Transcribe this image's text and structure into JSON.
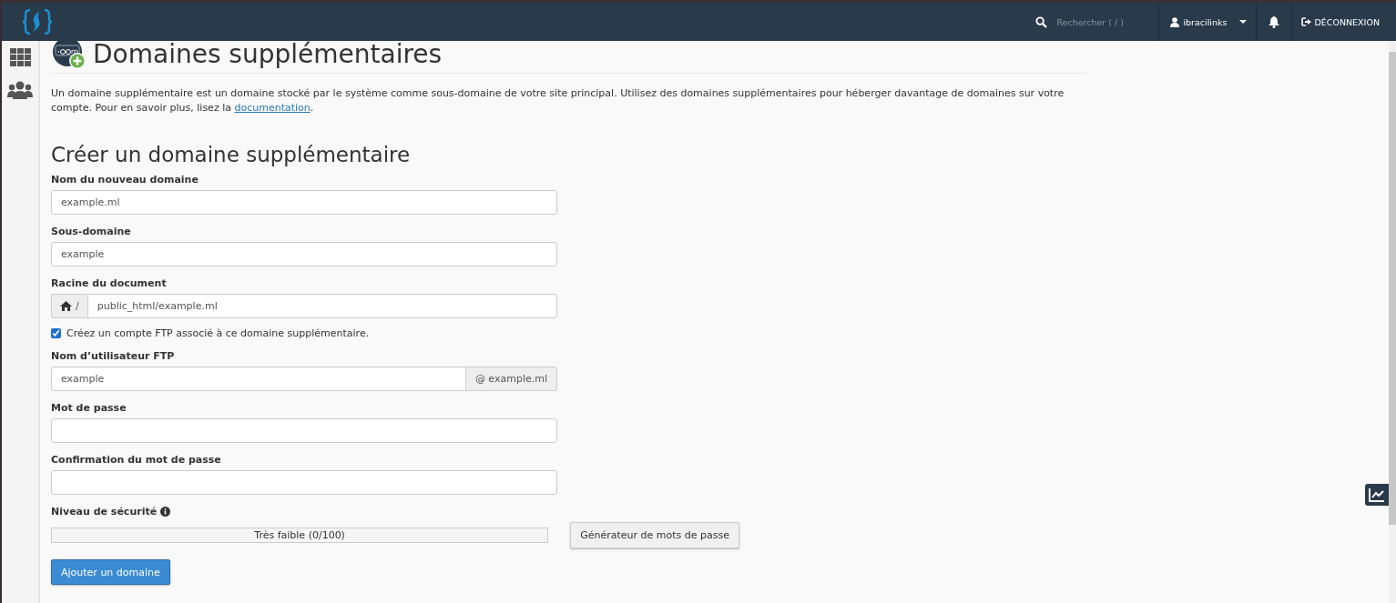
{
  "navbar": {
    "search": {
      "placeholder": "Rechercher ( / )"
    },
    "user": "ibracilinks",
    "logout": "DÉCONNEXION"
  },
  "page": {
    "title": "Domaines supplémentaires",
    "intro": "Un domaine supplémentaire est un domaine stocké par le système comme sous-domaine de votre site principal. Utilisez des domaines supplémentaires pour héberger davantage de domaines sur votre compte. Pour en savoir plus, lisez la ",
    "intro_link": "documentation",
    "intro_end": "."
  },
  "form": {
    "heading": "Créer un domaine supplémentaire",
    "items": [
      {
        "kind": "field",
        "label": "Nom du nouveau domaine",
        "value": "example.ml"
      },
      {
        "kind": "field",
        "label": "Sous-domaine",
        "value": "example"
      },
      {
        "kind": "prefixed",
        "label": "Racine du document",
        "prefix": "/",
        "value": "public_html/example.ml"
      },
      {
        "kind": "checkbox",
        "label": "Créez un compte FTP associé à ce domaine supplémentaire.",
        "checked": true
      },
      {
        "kind": "suffixed",
        "label": "Nom d’utilisateur FTP",
        "value": "example",
        "suffix": "@ example.ml"
      },
      {
        "kind": "password",
        "label": "Mot de passe"
      },
      {
        "kind": "password",
        "label": "Confirmation du mot de passe"
      }
    ],
    "strength": {
      "label": "Niveau de sécurité",
      "level": 0,
      "reading": "Très faible (0/100)",
      "generator": "Générateur de mots de passe"
    },
    "submit": "Ajouter un domaine"
  }
}
